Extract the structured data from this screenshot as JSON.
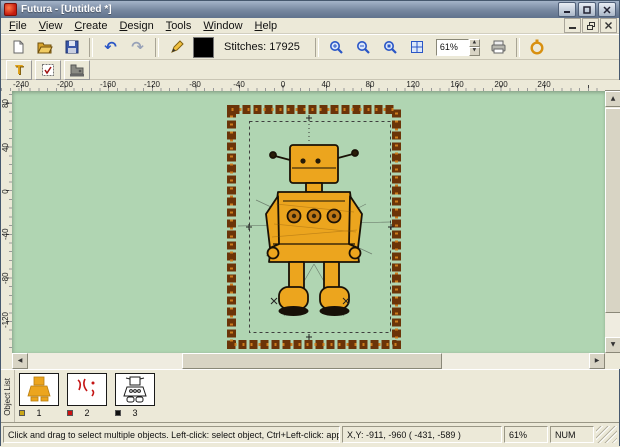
{
  "window": {
    "title": "Futura - [Untitled *]"
  },
  "menu": {
    "items": [
      "File",
      "View",
      "Create",
      "Design",
      "Tools",
      "Window",
      "Help"
    ]
  },
  "toolbar_main": {
    "stitches_label": "Stitches: 17925",
    "zoom_value": "61%",
    "icons": [
      "new",
      "open",
      "save",
      "undo",
      "redo",
      "pen",
      "thread-color",
      "zoom-in",
      "zoom-out",
      "zoom-selection",
      "grid",
      "print",
      "hoop"
    ],
    "undo_glyph": "↶",
    "redo_glyph": "↷",
    "spin_up": "▲",
    "spin_down": "▼"
  },
  "toolbar_tools": {
    "lettering_label": "T",
    "icons": [
      "lettering",
      "monogram",
      "sewing-machine"
    ]
  },
  "rulers": {
    "horizontal_labels": [
      "-240",
      "-200",
      "-160",
      "-120",
      "-80",
      "-40",
      "0",
      "40",
      "80",
      "120",
      "160",
      "200",
      "240"
    ],
    "vertical_labels": [
      "80",
      "40",
      "0",
      "-40",
      "-80",
      "-120"
    ]
  },
  "scrollbars": {
    "up": "▲",
    "down": "▼",
    "left": "◀",
    "right": "▶"
  },
  "colors": {
    "thread_swatch": "#000000",
    "canvas_background": "#b0d5b2",
    "robot_fill": "#eca51e",
    "hoop_frame": "#6b3408",
    "hoop_accent": "#cd7d1d"
  },
  "object_list": {
    "panel_label": "Object List",
    "items": [
      {
        "number": "1",
        "color": "#caa616"
      },
      {
        "number": "2",
        "color": "#cc1111"
      },
      {
        "number": "3",
        "color": "#111111"
      }
    ]
  },
  "status_bar": {
    "help_text": "Click and drag to select multiple objects. Left-click: select object, Ctrl+Left-click: append/detach selection",
    "coords": "X,Y: -911, -960  ( -431, -589 )",
    "zoom": "61%",
    "keyboard": "NUM"
  }
}
